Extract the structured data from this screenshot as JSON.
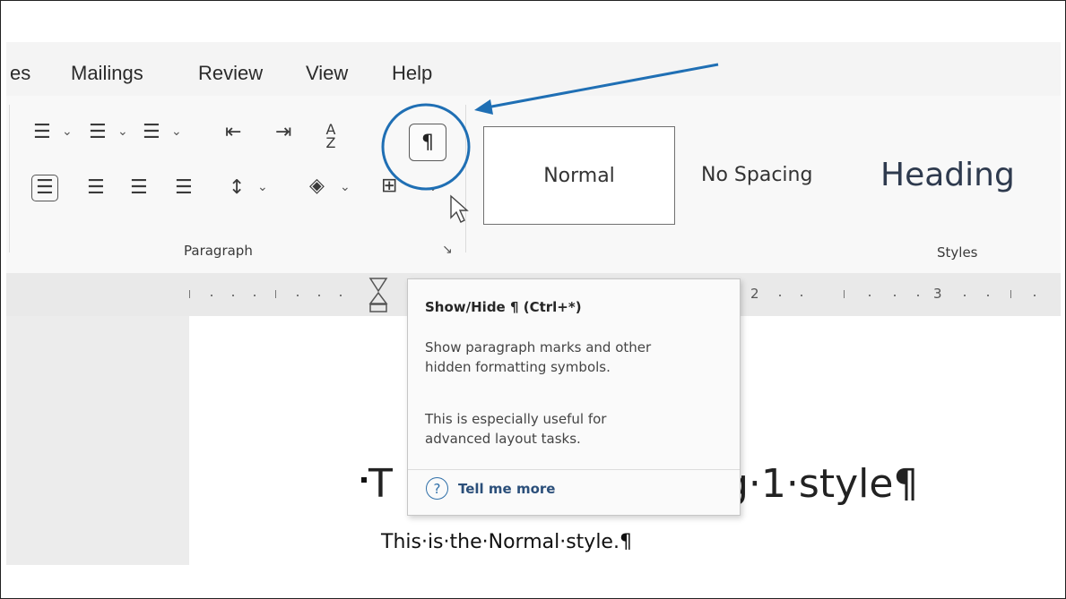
{
  "tabs": [
    {
      "label": "es"
    },
    {
      "label": "Mailings"
    },
    {
      "label": "Review"
    },
    {
      "label": "View"
    },
    {
      "label": "Help"
    }
  ],
  "icons": {
    "bullets": "bullet-list-icon",
    "numbering": "numbered-list-icon",
    "multilevel": "multilevel-list-icon",
    "decrease_indent": "decrease-indent-icon",
    "increase_indent": "increase-indent-icon",
    "sort": "sort-icon",
    "show_hide": "pilcrow-icon",
    "align_left": "align-left-icon",
    "center": "align-center-icon",
    "align_right": "align-right-icon",
    "justify": "justify-icon",
    "line_spacing": "line-spacing-icon",
    "shading": "shading-icon",
    "borders": "borders-icon"
  },
  "glyphs": {
    "pilcrow": "¶",
    "sort": "A Z",
    "dropdown": "⌄",
    "launcher": "↘",
    "help": "?"
  },
  "ribbon": {
    "paragraph_group_label": "Paragraph",
    "styles_group_label": "Styles",
    "styles": [
      {
        "label": "Normal"
      },
      {
        "label": "No Spacing"
      },
      {
        "label": "Heading"
      }
    ]
  },
  "ruler": {
    "numbers": [
      "2",
      "3"
    ]
  },
  "document": {
    "heading_left": "T",
    "heading_right": "g·1·style¶",
    "normal_line": "This·is·the·Normal·style.¶"
  },
  "tooltip": {
    "title": "Show/Hide ¶ (Ctrl+*)",
    "body_line1": "Show paragraph marks and other",
    "body_line2": "hidden formatting symbols.",
    "body_line3": "This is especially useful for",
    "body_line4": "advanced layout tasks.",
    "link": "Tell me more"
  },
  "colors": {
    "annotation": "#1f6fb4",
    "link": "#2b4f7a"
  }
}
